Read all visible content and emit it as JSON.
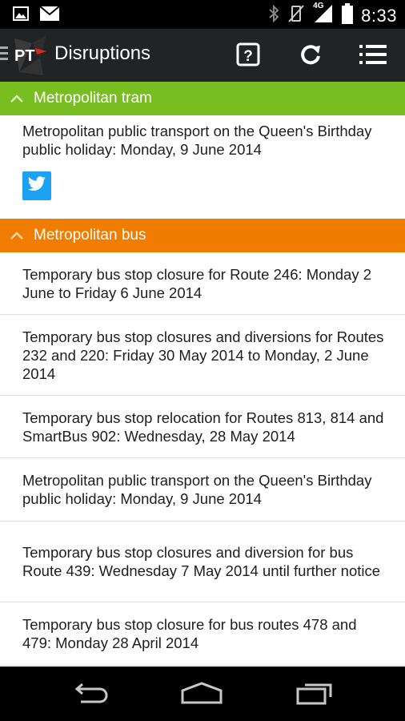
{
  "status_bar": {
    "time": "8:33",
    "network": "4G",
    "left_icons": [
      "image-icon",
      "email-icon"
    ],
    "right_icons": [
      "bluetooth-icon",
      "vibrate-off-icon",
      "signal-icon",
      "battery-icon"
    ]
  },
  "action_bar": {
    "logo_text": "PT",
    "title": "Disruptions",
    "buttons": [
      "help-icon",
      "refresh-icon",
      "list-icon"
    ]
  },
  "sections": {
    "tram": {
      "title": "Metropolitan tram",
      "color": "#78be20",
      "items": [
        "Metropolitan public transport on the Queen's Birthday public holiday: Monday, 9 June 2014"
      ]
    },
    "bus": {
      "title": "Metropolitan bus",
      "color": "#f07c00",
      "items": [
        "Temporary bus stop closure for Route 246: Monday 2 June to Friday 6 June 2014",
        "Temporary bus stop closures and diversions for Routes 232 and 220: Friday 30 May 2014 to Monday, 2 June 2014",
        "Temporary bus stop relocation for Routes 813, 814 and SmartBus 902: Wednesday, 28 May 2014",
        "Metropolitan public transport on the Queen's Birthday public holiday: Monday, 9 June 2014",
        "Temporary bus stop closures and diversion for bus Route 439: Wednesday 7 May 2014 until further notice",
        "Temporary bus stop closure for bus routes 478 and 479: Monday 28 April 2014"
      ]
    }
  },
  "colors": {
    "twitter": "#1da1f2",
    "action_bar": "#222325"
  }
}
